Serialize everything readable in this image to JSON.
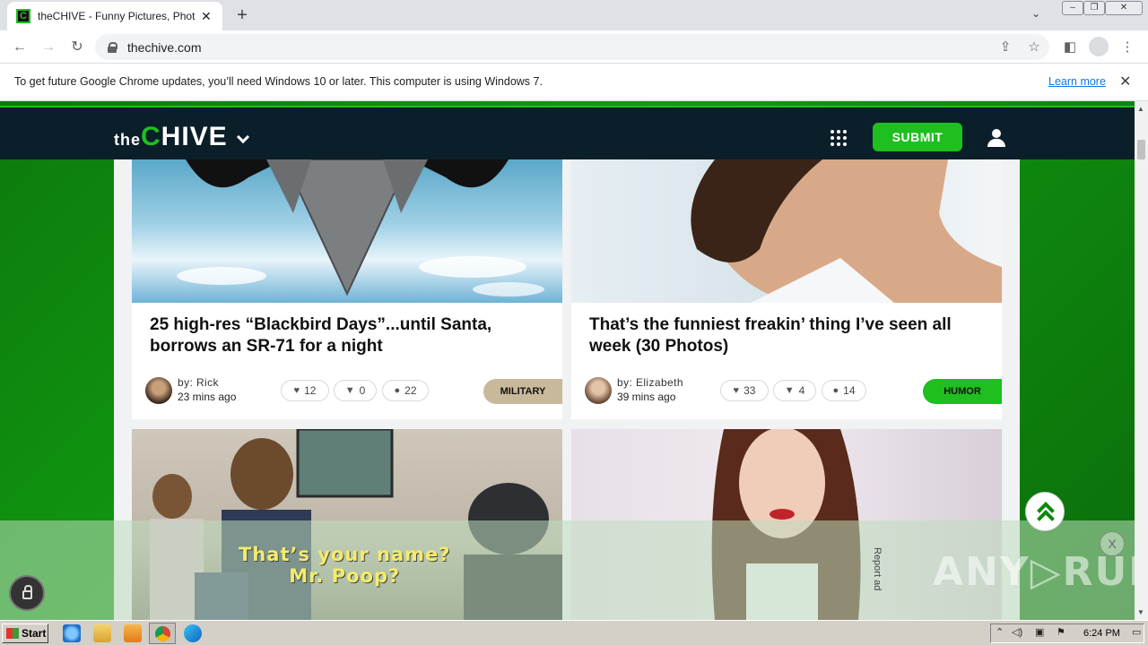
{
  "browser": {
    "tab_title": "theCHIVE - Funny Pictures, Photos, Memes & Videos",
    "tab_favicon": "C",
    "url": "thechive.com",
    "infobar_message": "To get future Google Chrome updates, you’ll need Windows 10 or later. This computer is using Windows 7.",
    "infobar_link": "Learn more"
  },
  "site": {
    "logo_the": "the",
    "logo_c": "C",
    "logo_hive": "HIVE",
    "submit_label": "SUBMIT"
  },
  "cards": [
    {
      "headline": "25 high-res “Blackbird Days”...until Santa, borrows an SR-71 for a night",
      "author": "by: Rick",
      "time": "23 mins ago",
      "likes": "12",
      "dislikes": "0",
      "comments": "22",
      "tag": "MILITARY",
      "tag_color": "#c8b99a"
    },
    {
      "headline": "That’s the funniest freakin’ thing I’ve seen all week (30 Photos)",
      "author": "by: Elizabeth",
      "time": "39 mins ago",
      "likes": "33",
      "dislikes": "4",
      "comments": "14",
      "tag": "HUMOR",
      "tag_color": "#1fbf1f"
    }
  ],
  "ad": {
    "caption_line1": "That’s your name?",
    "caption_line2": "Mr. Poop?",
    "report": "Report ad",
    "close": "X"
  },
  "watermark": "ANY▷RUN",
  "taskbar": {
    "start_label": "Start",
    "clock": "6:24 PM"
  },
  "colors": {
    "brand_green": "#1fbf1f",
    "header_dark": "#0b1f2a"
  }
}
